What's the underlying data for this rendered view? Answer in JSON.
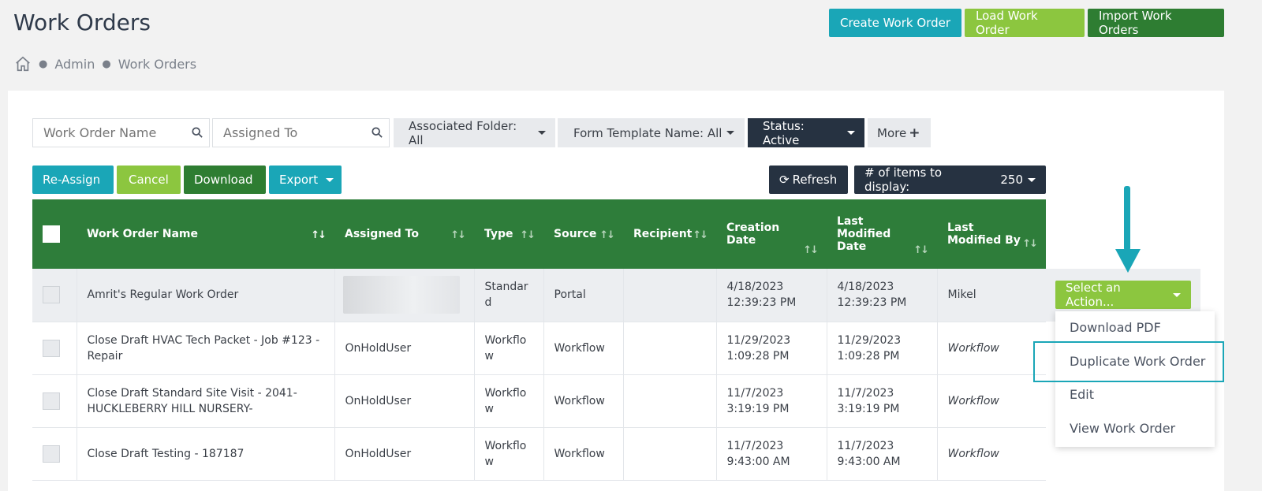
{
  "page": {
    "title": "Work Orders"
  },
  "breadcrumb": {
    "items": [
      "Admin",
      "Work Orders"
    ]
  },
  "header_buttons": {
    "create": "Create Work Order",
    "load": "Load Work Order",
    "import": "Import Work Orders"
  },
  "filters": {
    "search_name_placeholder": "Work Order Name",
    "search_assigned_placeholder": "Assigned To",
    "associated_folder": "Associated Folder: All",
    "form_template": "Form Template Name: All",
    "status": "Status: Active",
    "more": "More"
  },
  "actions": {
    "reassign": "Re-Assign",
    "cancel": "Cancel",
    "download": "Download",
    "export": "Export",
    "refresh": "Refresh",
    "items_label": "# of items to display:",
    "items_value": "250"
  },
  "table": {
    "columns": {
      "name": "Work Order Name",
      "assigned": "Assigned To",
      "type": "Type",
      "source": "Source",
      "recipient": "Recipient",
      "creation_1": "Creation",
      "creation_2": "Date",
      "lastmod_1": "Last",
      "lastmod_2": "Modified",
      "lastmod_3": "Date",
      "lastby_1": "Last",
      "lastby_2": "Modified By"
    },
    "rows": [
      {
        "name": "Amrit's Regular Work Order",
        "assigned": "",
        "type": "Standar d",
        "source": "Portal",
        "recipient": "",
        "created": "4/18/2023 12:39:23 PM",
        "modified": "4/18/2023 12:39:23 PM",
        "modified_by": "Mikel"
      },
      {
        "name": "Close Draft HVAC Tech Packet - Job #123 - Repair",
        "assigned": "OnHoldUser",
        "type": "Workflo w",
        "source": "Workflow",
        "recipient": "",
        "created": "11/29/2023 1:09:28 PM",
        "modified": "11/29/2023 1:09:28 PM",
        "modified_by": "Workflow"
      },
      {
        "name": "Close Draft Standard Site Visit - 2041-HUCKLEBERRY HILL NURSERY-",
        "assigned": "OnHoldUser",
        "type": "Workflo w",
        "source": "Workflow",
        "recipient": "",
        "created": "11/7/2023 3:19:19 PM",
        "modified": "11/7/2023 3:19:19 PM",
        "modified_by": "Workflow"
      },
      {
        "name": "Close Draft Testing - 187187",
        "assigned": "OnHoldUser",
        "type": "Workflo w",
        "source": "Workflow",
        "recipient": "",
        "created": "11/7/2023 9:43:00 AM",
        "modified": "11/7/2023 9:43:00 AM",
        "modified_by": "Workflow"
      }
    ]
  },
  "row_action": {
    "select_label": "Select an Action...",
    "menu": [
      "Download PDF",
      "Duplicate Work Order",
      "Edit",
      "View Work Order"
    ]
  },
  "colors": {
    "teal": "#1aa6b7",
    "lime": "#8cc63f",
    "dark_green": "#2e7d32",
    "navy": "#263241"
  }
}
